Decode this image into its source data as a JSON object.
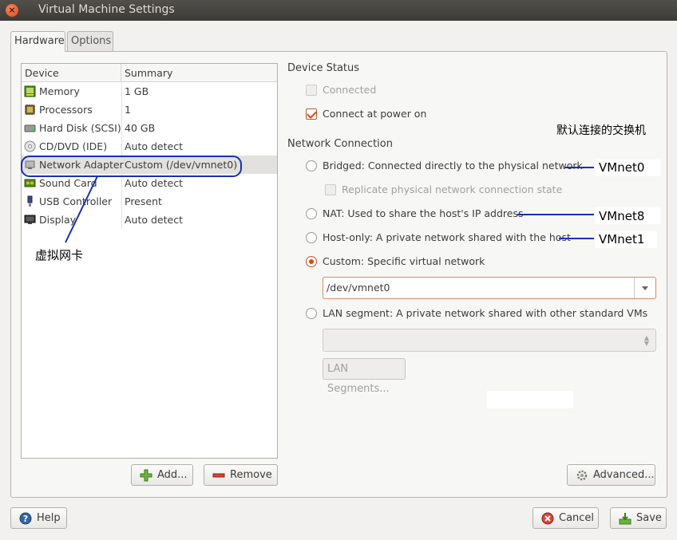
{
  "window": {
    "title": "Virtual Machine Settings",
    "close_glyph": "×"
  },
  "tabs": [
    {
      "label": "Hardware",
      "active": true
    },
    {
      "label": "Options",
      "active": false
    }
  ],
  "device_list": {
    "headers": {
      "device": "Device",
      "summary": "Summary"
    },
    "rows": [
      {
        "device": "Memory",
        "summary": "1 GB",
        "icon": "memory-icon"
      },
      {
        "device": "Processors",
        "summary": "1",
        "icon": "processor-icon"
      },
      {
        "device": "Hard Disk (SCSI)",
        "summary": "40 GB",
        "icon": "hard-disk-icon"
      },
      {
        "device": "CD/DVD (IDE)",
        "summary": "Auto detect",
        "icon": "cd-dvd-icon"
      },
      {
        "device": "Network Adapter",
        "summary": "Custom (/dev/vmnet0)",
        "icon": "network-adapter-icon",
        "selected": true
      },
      {
        "device": "Sound Card",
        "summary": "Auto detect",
        "icon": "sound-card-icon"
      },
      {
        "device": "USB Controller",
        "summary": "Present",
        "icon": "usb-icon"
      },
      {
        "device": "Display",
        "summary": "Auto detect",
        "icon": "display-icon"
      }
    ]
  },
  "list_buttons": {
    "add": "Add...",
    "remove": "Remove"
  },
  "device_status": {
    "title": "Device Status",
    "connected": {
      "label": "Connected",
      "checked": false,
      "disabled": true
    },
    "connect_at_power_on": {
      "label": "Connect at power on",
      "checked": true
    }
  },
  "network_connection": {
    "title": "Network Connection",
    "bridged": "Bridged: Connected directly to the physical network",
    "replicate": "Replicate physical network connection state",
    "nat": "NAT: Used to share the host's IP address",
    "host_only": "Host-only: A private network shared with the host",
    "custom": "Custom: Specific virtual network",
    "custom_value": "/dev/vmnet0",
    "lan_segment": "LAN segment: A private network shared with other standard VMs",
    "lan_segment_value": "",
    "lan_segments_button": "LAN Segments...",
    "selected": "custom"
  },
  "advanced_button": "Advanced...",
  "footer": {
    "help": "Help",
    "cancel": "Cancel",
    "save": "Save"
  },
  "annotations": {
    "default_switch": "默认连接的交换机",
    "vmnet0": "VMnet0",
    "vmnet8": "VMnet8",
    "vmnet1": "VMnet1",
    "virtual_nic": "虚拟网卡"
  },
  "colors": {
    "accent": "#dd4814",
    "annotation_line": "#1a2fb4"
  }
}
